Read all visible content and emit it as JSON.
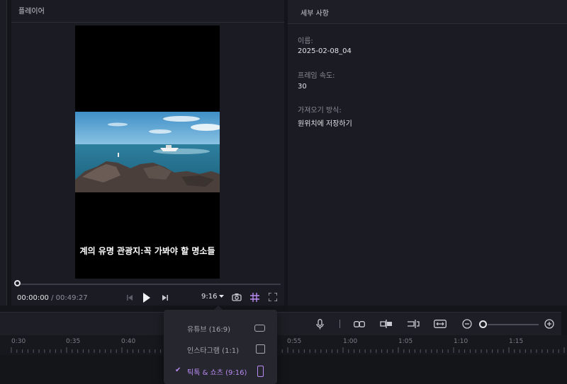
{
  "player": {
    "title": "플레이어",
    "subtitle": "계의 유명 관광지:꼭 가봐야 할 명소들",
    "current_time": "00:00:00",
    "separator": " / ",
    "duration": "00:49:27",
    "aspect_ratio": "9:16",
    "progress": 0
  },
  "details": {
    "title": "세부 사항",
    "fields": [
      {
        "label": "이름:",
        "value": "2025-02-08_04"
      },
      {
        "label": "프레임 속도:",
        "value": "30"
      },
      {
        "label": "가져오기 방식:",
        "value": "원위치에 저장하기"
      }
    ]
  },
  "dropdown": {
    "items": [
      {
        "label": "유튜브 (16:9)",
        "shape": "landscape",
        "selected": false
      },
      {
        "label": "인스타그램 (1:1)",
        "shape": "square",
        "selected": false
      },
      {
        "label": "틱톡 & 쇼츠 (9:16)",
        "shape": "portrait",
        "selected": true
      }
    ]
  },
  "timeline": {
    "ticks": [
      "0:30",
      "0:35",
      "0:40",
      "0:55",
      "1:00",
      "1:05",
      "1:10",
      "1:15"
    ]
  },
  "icons": {
    "prev": "skip-back-icon",
    "play": "play-icon",
    "next": "skip-forward-icon",
    "snapshot": "camera-icon",
    "grid": "grid-icon",
    "fullscreen": "fullscreen-icon",
    "mic": "microphone-icon",
    "link": "link-icon",
    "split": "split-icon",
    "trim": "trim-icon",
    "fit": "fit-width-icon",
    "zoom_out": "zoom-out-icon",
    "zoom_in": "zoom-in-icon"
  },
  "colors": {
    "accent": "#b98bf2",
    "background": "#14151b",
    "panel": "#1b1c23"
  }
}
